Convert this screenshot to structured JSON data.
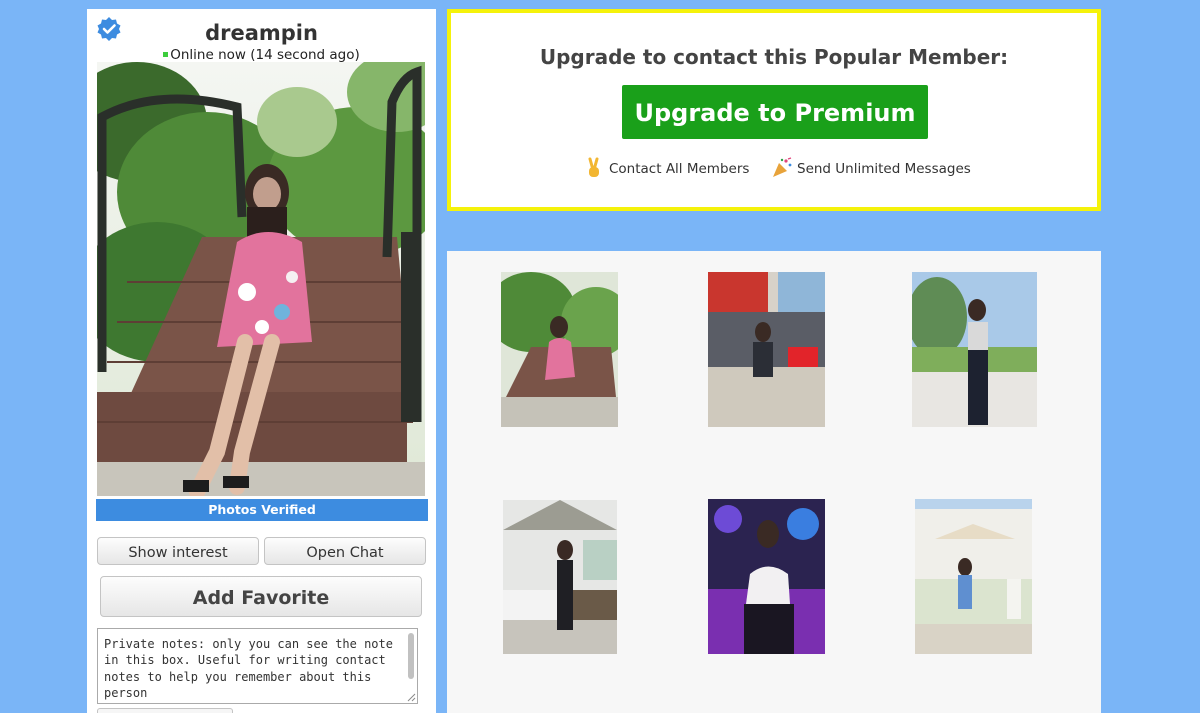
{
  "profile": {
    "username": "dreampin",
    "online_status": "Online now (14 second ago)",
    "photos_verified_label": "Photos Verified",
    "show_interest_label": "Show interest",
    "open_chat_label": "Open Chat",
    "add_favorite_label": "Add Favorite",
    "notes_text": "Private notes: only you can see the note in this box. Useful for writing contact notes to help you remember about this person"
  },
  "upgrade": {
    "heading": "Upgrade to contact this Popular Member:",
    "button_label": "Upgrade to Premium",
    "features": [
      {
        "icon": "victory-hand-icon",
        "label": "Contact All Members"
      },
      {
        "icon": "party-popper-icon",
        "label": "Send Unlimited Messages"
      }
    ]
  },
  "colors": {
    "page_background": "#7ab5f7",
    "verified_bar": "#3d8ce0",
    "upgrade_button": "#1aa01a",
    "upgrade_border": "#f5f20b",
    "online_dot": "#3ccd3c"
  }
}
